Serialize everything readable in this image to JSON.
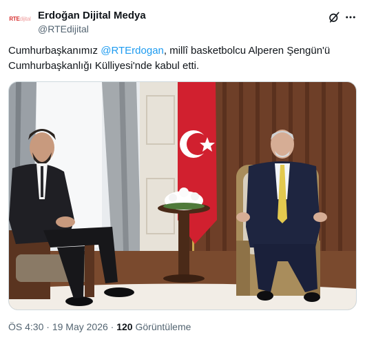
{
  "author": {
    "name": "Erdoğan Dijital Medya",
    "handle": "@RTEdijital",
    "avatar_text_bold": "RTE",
    "avatar_text_light": "dijital"
  },
  "tweet": {
    "text_before": "Cumhurbaşkanımız ",
    "mention": "@RTErdogan",
    "text_after": ", millî basketbolcu Alperen Şengün'ü Cumhurbaşkanlığı Külliyesi'nde kabul etti."
  },
  "meta": {
    "time": "ÖS 4:30",
    "sep1": " · ",
    "date": "19 May 2026",
    "sep2": " · ",
    "views_count": "120",
    "views_label": " Görüntüleme"
  },
  "icons": {
    "grok": "grok-icon",
    "more": "more-icon"
  },
  "colors": {
    "link": "#1d9bf0",
    "secondary_text": "#536471",
    "flag_red": "#d1202f"
  }
}
